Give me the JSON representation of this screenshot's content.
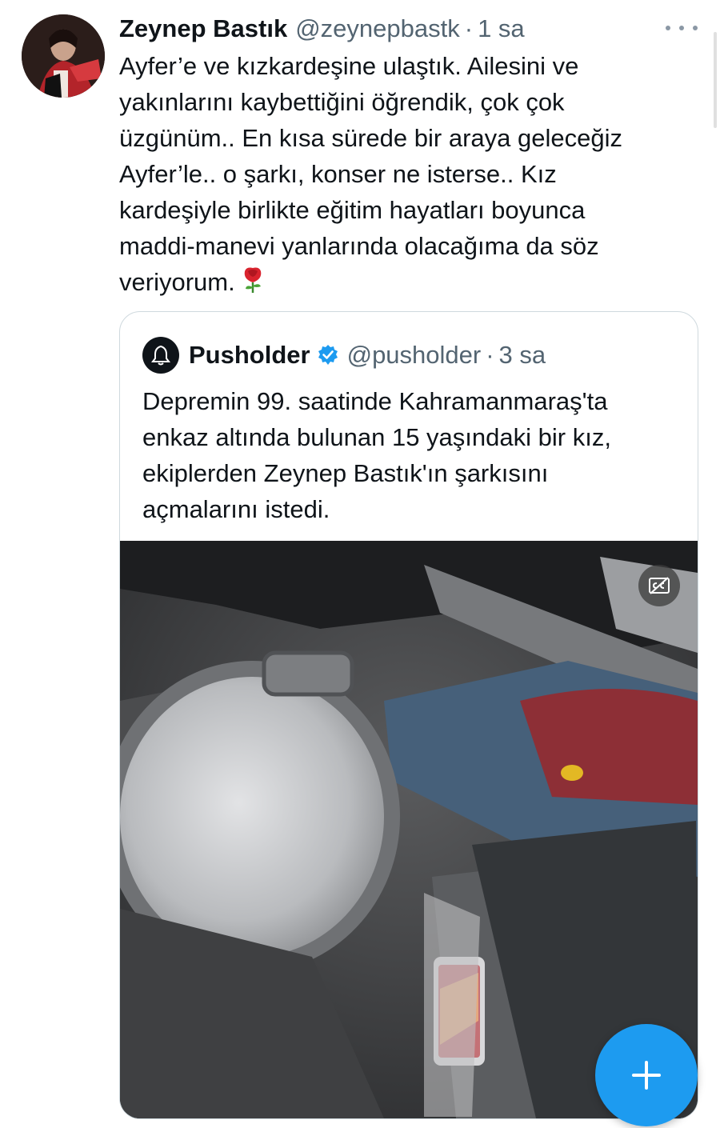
{
  "tweet": {
    "name": "Zeynep Bastık",
    "handle": "@zeynepbastk",
    "separator": "·",
    "time": "1 sa",
    "lines": [
      "Ayfer’e ve kızkardeşine ulaştık. Ailesini ve",
      "yakınlarını kaybettiğini öğrendik, çok çok",
      "üzgünüm.. En kısa sürede bir araya geleceğiz",
      "Ayfer’le.. o şarkı, konser ne isterse.. Kız",
      "kardeşiyle birlikte eğitim hayatları boyunca",
      "maddi-manevi yanlarında olacağıma da söz",
      "veriyorum."
    ],
    "more_icon": "more-horizontal-icon",
    "emoji_icon": "rose-emoji"
  },
  "quoted": {
    "name": "Pusholder",
    "handle": "@pusholder",
    "separator": "·",
    "time": "3 sa",
    "verified_icon": "verified-badge-icon",
    "lines": [
      "Depremin 99. saatinde Kahramanmaraş'ta",
      "enkaz altında bulunan 15 yaşındaki bir kız,",
      "ekiplerden Zeynep Bastık'ın şarkısını",
      "açmalarını istedi."
    ],
    "media_caption_icon": "closed-captions-icon"
  },
  "compose": {
    "icon": "plus-icon"
  },
  "colors": {
    "accent": "#1d9bf0",
    "text": "#0f1419",
    "secondary": "#536471",
    "border": "#cfd9de"
  }
}
